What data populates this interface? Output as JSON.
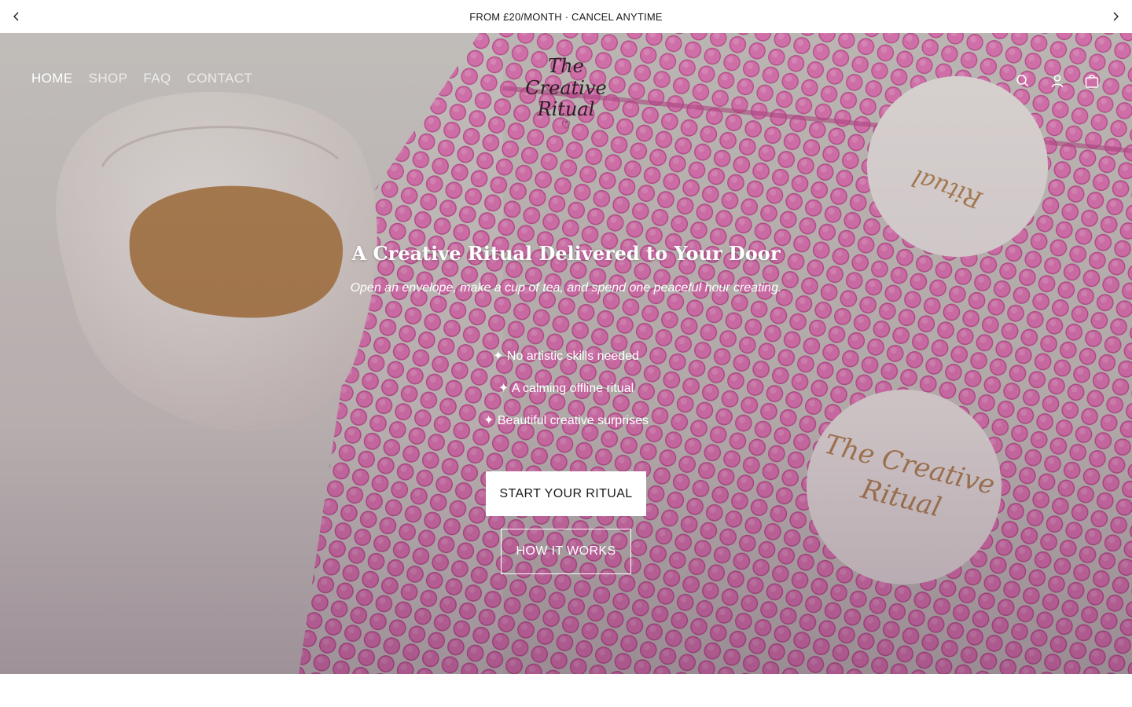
{
  "announcement": {
    "text": "FROM £20/MONTH · CANCEL ANYTIME",
    "prev_icon": "chevron-left-icon",
    "next_icon": "chevron-right-icon"
  },
  "header": {
    "nav": [
      "HOME",
      "SHOP",
      "FAQ",
      "CONTACT"
    ],
    "active": "HOME",
    "logo": {
      "line1": "The Creative",
      "line2": "Ritual",
      "heart": "♡"
    },
    "icons": [
      "search-icon",
      "account-icon",
      "cart-icon"
    ]
  },
  "hero": {
    "title": "A Creative Ritual Delivered to Your Door",
    "subtitle": "Open an envelope, make a cup of tea, and spend one peaceful hour creating.",
    "features": [
      "✦ No artistic skills needed",
      "✦ A calming offline ritual",
      "✦ Beautiful creative surprises"
    ],
    "primary_button": "START YOUR RITUAL",
    "secondary_button": "HOW IT WORKS"
  },
  "colors": {
    "envelope_pink": "#e36fb4",
    "background_grey": "#cfcac6",
    "text_dark": "#1a1a1a"
  }
}
